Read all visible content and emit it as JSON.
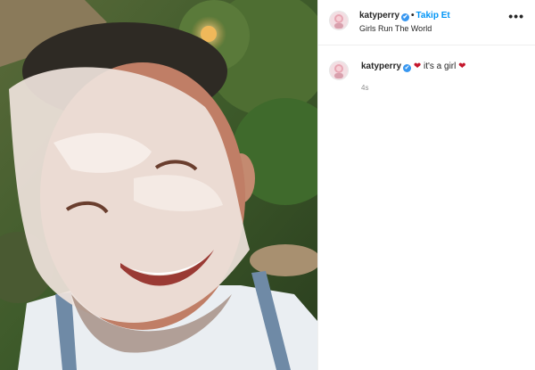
{
  "post": {
    "author": {
      "username": "katyperry",
      "verified_mark": "✔",
      "separator": "•",
      "follow_label": "Takip Et",
      "subtitle": "Girls Run The World"
    },
    "more_icon": "•••",
    "caption": {
      "username": "katyperry",
      "heart_left": "❤",
      "text": "it's a girl",
      "heart_right": "❤",
      "time": "4s"
    }
  },
  "colors": {
    "link_blue": "#0095f6",
    "verified_blue": "#3897f0",
    "heart_red": "#c5162b",
    "muted": "#8e8e8e"
  },
  "icons": [
    "verified-badge-icon",
    "more-options-icon",
    "heart-emoji-icon"
  ]
}
